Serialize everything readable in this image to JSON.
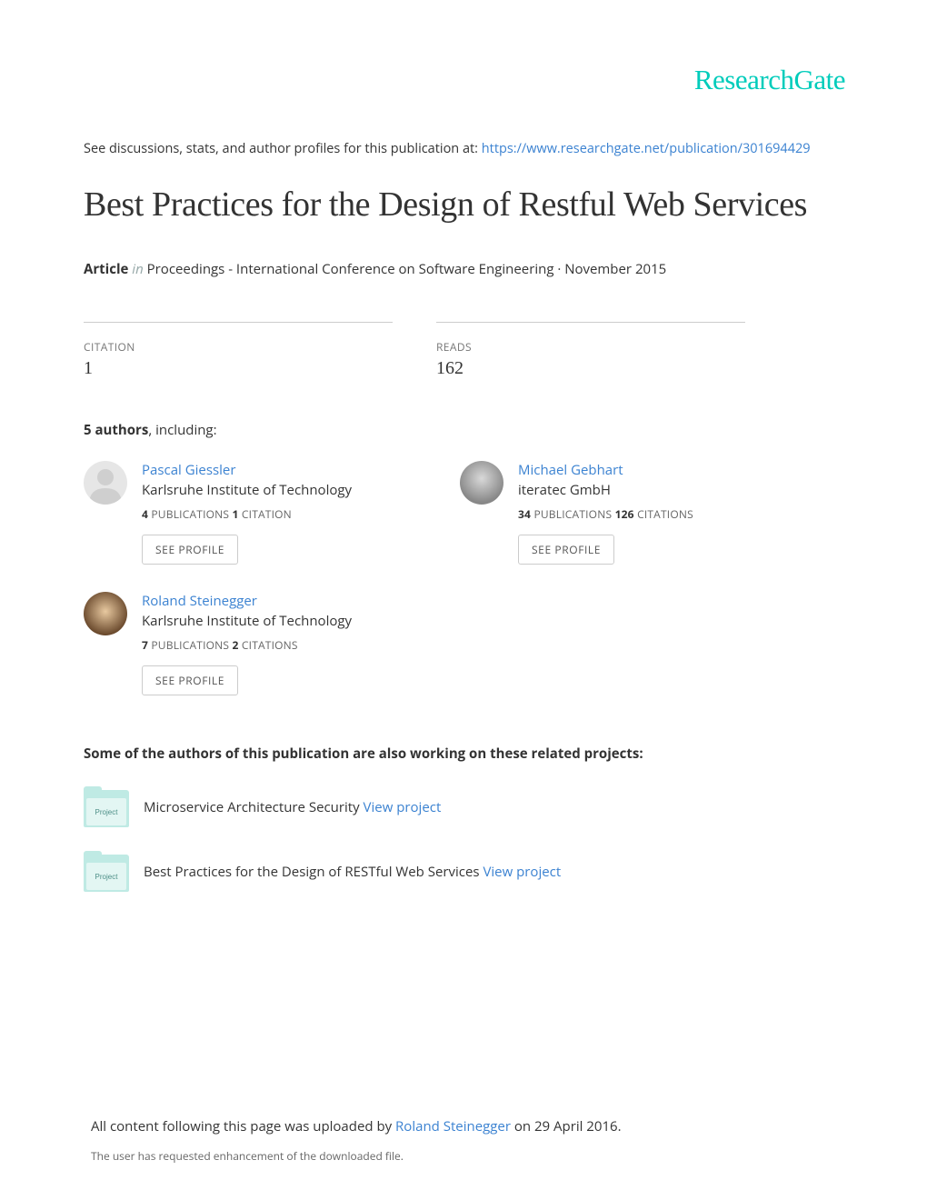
{
  "logo": "ResearchGate",
  "discover": {
    "prefix": "See discussions, stats, and author profiles for this publication at: ",
    "link_text": "https://www.researchgate.net/publication/301694429"
  },
  "title": "Best Practices for the Design of Restful Web Services",
  "pub_meta": {
    "article_label": "Article",
    "in_label": " in ",
    "venue": " Proceedings - International Conference on Software Engineering · November 2015"
  },
  "stats": {
    "citation_label": "CITATION",
    "citation_value": "1",
    "reads_label": "READS",
    "reads_value": "162"
  },
  "authors_intro": {
    "bold": "5 authors",
    "rest": ", including:"
  },
  "authors": [
    {
      "name": "Pascal Giessler",
      "affiliation": "Karlsruhe Institute of Technology",
      "pubs_n": "4",
      "pubs_label": " PUBLICATIONS   ",
      "cites_n": "1",
      "cites_label": " CITATION   ",
      "see_profile": "SEE PROFILE",
      "avatar_class": "default"
    },
    {
      "name": "Michael Gebhart",
      "affiliation": "iteratec GmbH",
      "pubs_n": "34",
      "pubs_label": " PUBLICATIONS   ",
      "cites_n": "126",
      "cites_label": " CITATIONS   ",
      "see_profile": "SEE PROFILE",
      "avatar_class": "photo1"
    },
    {
      "name": "Roland Steinegger",
      "affiliation": "Karlsruhe Institute of Technology",
      "pubs_n": "7",
      "pubs_label": " PUBLICATIONS   ",
      "cites_n": "2",
      "cites_label": " CITATIONS   ",
      "see_profile": "SEE PROFILE",
      "avatar_class": "photo2"
    }
  ],
  "projects_intro": "Some of the authors of this publication are also working on these related projects:",
  "projects": [
    {
      "icon_label": "Project",
      "title": "Microservice Architecture Security ",
      "view_text": "View project"
    },
    {
      "icon_label": "Project",
      "title": "Best Practices for the Design of RESTful Web Services ",
      "view_text": "View project"
    }
  ],
  "footer": {
    "upload_prefix": "All content following this page was uploaded by ",
    "upload_author": "Roland Steinegger",
    "upload_suffix": " on 29 April 2016.",
    "enhance": "The user has requested enhancement of the downloaded file."
  }
}
